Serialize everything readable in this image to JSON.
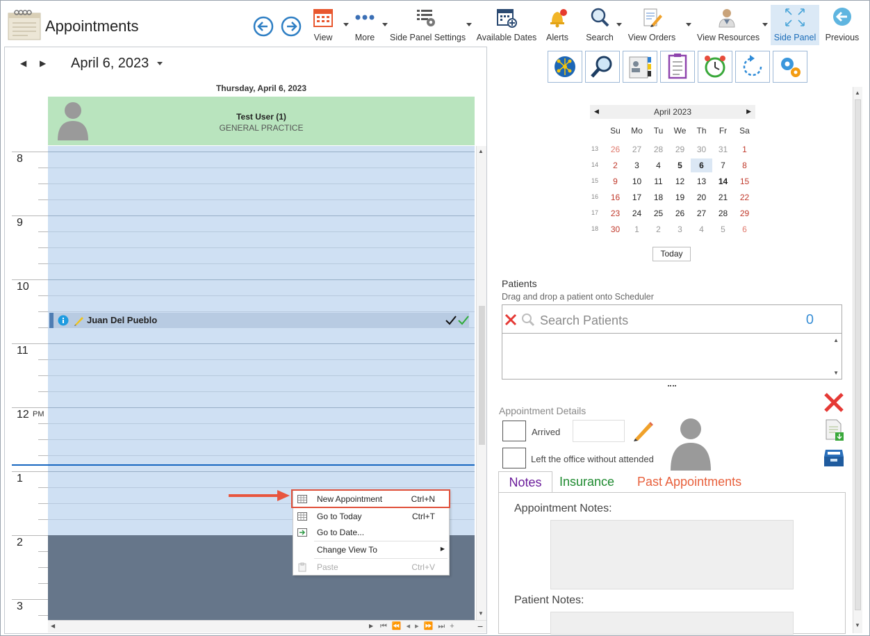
{
  "app": {
    "title": "Appointments"
  },
  "toolbar": {
    "buttons": [
      {
        "label": "View"
      },
      {
        "label": "More"
      },
      {
        "label": "Side Panel Settings"
      },
      {
        "label": "Available Dates"
      },
      {
        "label": "Alerts"
      },
      {
        "label": "Search"
      },
      {
        "label": "View Orders"
      },
      {
        "label": "View Resources"
      },
      {
        "label": "Side Panel"
      },
      {
        "label": "Previous"
      }
    ],
    "active": "Side Panel",
    "accent": "#1b6cb8"
  },
  "scheduler": {
    "date": "April 6, 2023",
    "day_header": "Thursday, April 6, 2023",
    "resource": {
      "name": "Test User (1)",
      "specialty": "GENERAL PRACTICE"
    },
    "hours": [
      "8",
      "9",
      "10",
      "11",
      "12",
      "1",
      "2",
      "3"
    ],
    "pm_marker": "PM",
    "appointment": {
      "patient": "Juan Del Pueblo"
    },
    "colors": {
      "slots": "#cfe0f3",
      "off_hours": "#66768a",
      "resource_header": "#b9e4be",
      "now_line": "#1565c0"
    }
  },
  "context_menu": {
    "items": [
      {
        "label": "New Appointment",
        "shortcut": "Ctrl+N"
      },
      {
        "label": "Go to Today",
        "shortcut": "Ctrl+T"
      },
      {
        "label": "Go to Date...",
        "shortcut": ""
      },
      {
        "label": "Change View To",
        "shortcut": ""
      },
      {
        "label": "Paste",
        "shortcut": "Ctrl+V",
        "disabled": true
      }
    ],
    "highlight_color": "#e0503a"
  },
  "mini_calendar": {
    "month": "April 2023",
    "dow": [
      "Su",
      "Mo",
      "Tu",
      "We",
      "Th",
      "Fr",
      "Sa"
    ],
    "weeks": [
      {
        "wk": "13",
        "days": [
          "26",
          "27",
          "28",
          "29",
          "30",
          "31",
          "1"
        ]
      },
      {
        "wk": "14",
        "days": [
          "2",
          "3",
          "4",
          "5",
          "6",
          "7",
          "8"
        ]
      },
      {
        "wk": "15",
        "days": [
          "9",
          "10",
          "11",
          "12",
          "13",
          "14",
          "15"
        ]
      },
      {
        "wk": "16",
        "days": [
          "16",
          "17",
          "18",
          "19",
          "20",
          "21",
          "22"
        ]
      },
      {
        "wk": "17",
        "days": [
          "23",
          "24",
          "25",
          "26",
          "27",
          "28",
          "29"
        ]
      },
      {
        "wk": "18",
        "days": [
          "30",
          "1",
          "2",
          "3",
          "4",
          "5",
          "6"
        ]
      }
    ],
    "today_button": "Today"
  },
  "patients": {
    "title": "Patients",
    "subtitle": "Drag and drop a patient onto Scheduler",
    "search_placeholder": "Search Patients",
    "count": "0"
  },
  "appointment_details": {
    "title": "Appointment Details",
    "arrived_label": "Arrived",
    "left_label": "Left the office without attended"
  },
  "tabs": {
    "notes": "Notes",
    "insurance": "Insurance",
    "past": "Past Appointments"
  },
  "notes": {
    "appointment_notes_label": "Appointment Notes:",
    "patient_notes_label": "Patient Notes:"
  }
}
